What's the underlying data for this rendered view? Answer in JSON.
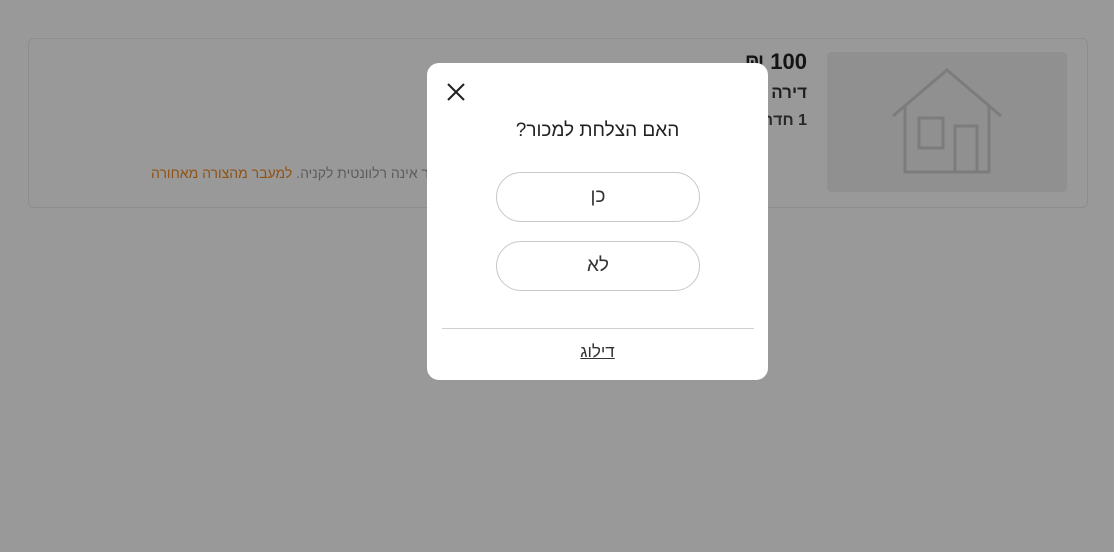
{
  "listing": {
    "price": "100 ₪",
    "property_type": "דירה",
    "rooms": "1 חדר",
    "note_text": "מודעה זו כבר אינה רלוונטית לקניה. ",
    "note_link": "למעבר מהצורה מאחורה"
  },
  "dialog": {
    "title": "האם הצלחת למכור?",
    "yes_label": "כן",
    "no_label": "לא",
    "skip_label": "דילוג"
  },
  "colors": {
    "overlay": "rgba(0,0,0,0.40)",
    "accent": "#f08a24",
    "modal_bg": "#ffffff"
  },
  "icons": {
    "close": "close-icon",
    "placeholder": "house-placeholder-icon"
  }
}
